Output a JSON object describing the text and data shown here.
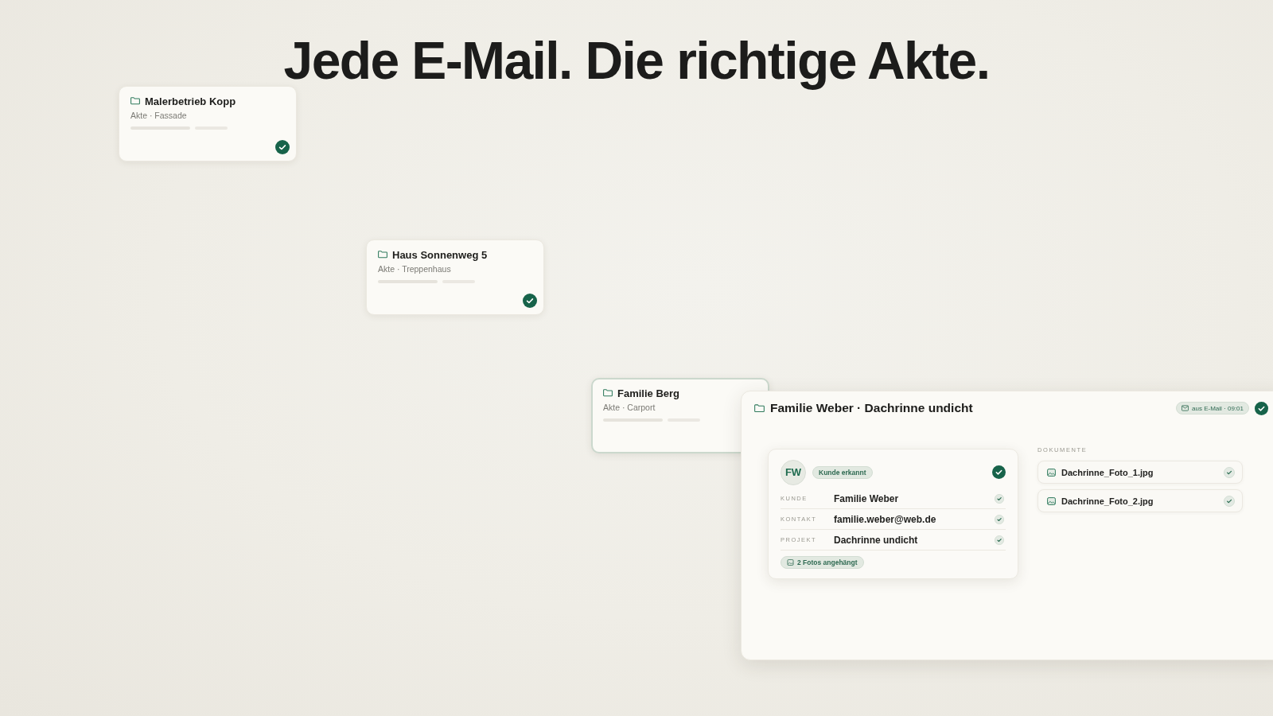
{
  "headline": "Jede E-Mail. Die richtige Akte.",
  "cards": [
    {
      "title": "Malerbetrieb Kopp",
      "subtitle": "Akte · Fassade",
      "checked": true,
      "highlighted": false
    },
    {
      "title": "Haus Sonnenweg 5",
      "subtitle": "Akte · Treppenhaus",
      "checked": true,
      "highlighted": false
    },
    {
      "title": "Familie Berg",
      "subtitle": "Akte · Carport",
      "highlighted": true
    }
  ],
  "case_panel": {
    "title": "Familie Weber · Dachrinne undicht",
    "source_badge": "aus E-Mail · 09:01",
    "checked": true,
    "customer_card": {
      "initials": "FW",
      "status_badge": "Kunde erkannt",
      "checked": true,
      "fields": [
        {
          "label": "KUNDE",
          "value": "Familie Weber",
          "checked": true
        },
        {
          "label": "KONTAKT",
          "value": "familie.weber@web.de",
          "checked": true
        },
        {
          "label": "PROJEKT",
          "value": "Dachrinne undicht",
          "checked": true
        }
      ],
      "attachment_badge": "2 Fotos angehängt"
    },
    "documents": {
      "heading": "DOKUMENTE",
      "files": [
        {
          "name": "Dachrinne_Foto_1.jpg",
          "checked": true
        },
        {
          "name": "Dachrinne_Foto_2.jpg",
          "checked": true
        }
      ]
    }
  }
}
